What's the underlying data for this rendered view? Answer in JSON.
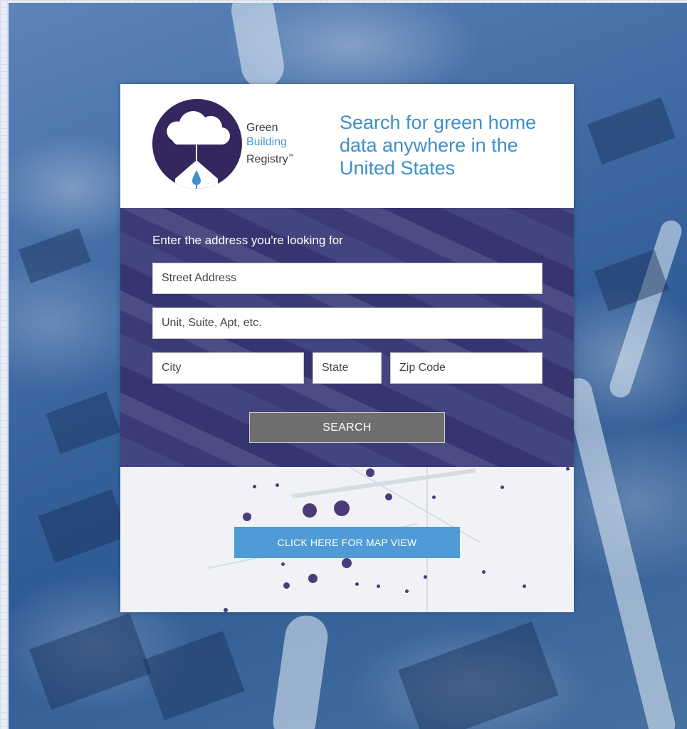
{
  "logo": {
    "line1": "Green",
    "line2": "Building",
    "line3": "Registry",
    "trademark": "™"
  },
  "tagline": "Search for green home data anywhere in the United States",
  "form": {
    "prompt": "Enter the address you're looking for",
    "street_placeholder": "Street Address",
    "unit_placeholder": "Unit, Suite, Apt, etc.",
    "city_placeholder": "City",
    "state_placeholder": "State",
    "zip_placeholder": "Zip Code",
    "search_label": "SEARCH"
  },
  "map": {
    "button_label": "CLICK HERE FOR MAP VIEW"
  },
  "colors": {
    "brand_purple": "#36265f",
    "brand_blue": "#3d8fcb",
    "map_button": "#4f9bd6",
    "search_button": "#6f6f6f"
  }
}
